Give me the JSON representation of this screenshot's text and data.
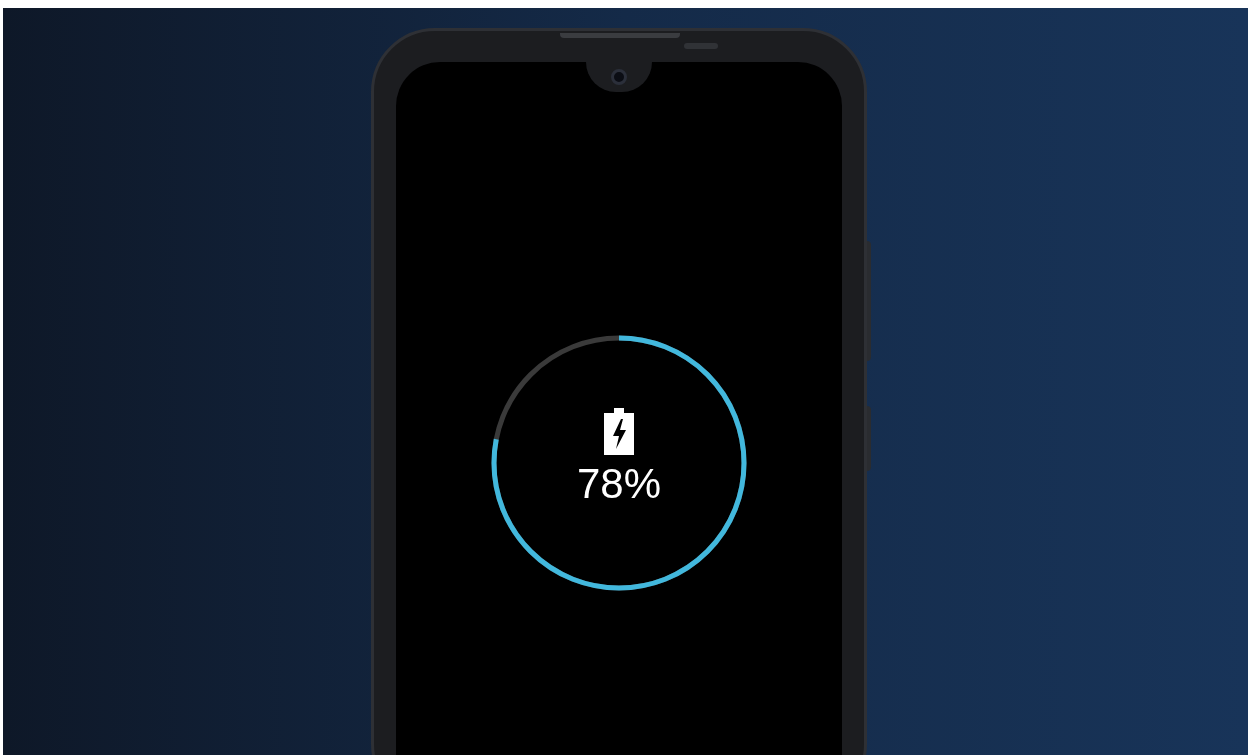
{
  "charging": {
    "level": 0.78,
    "reading": "78%"
  }
}
